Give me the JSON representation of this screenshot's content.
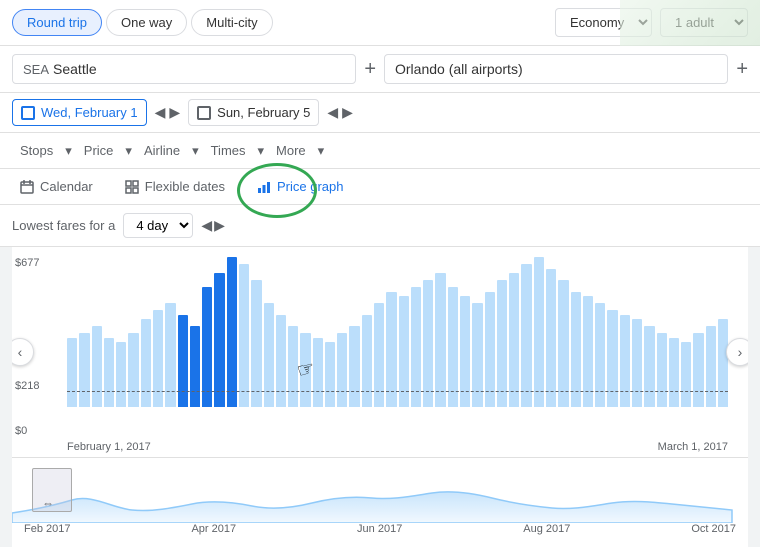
{
  "tripTypes": [
    {
      "label": "Round trip",
      "active": true
    },
    {
      "label": "One way",
      "active": false
    },
    {
      "label": "Multi-city",
      "active": false
    }
  ],
  "cabin": {
    "label": "Economy",
    "value": "economy"
  },
  "passengers": {
    "label": "1 adult"
  },
  "origin": {
    "iata": "SEA",
    "city": "Seattle"
  },
  "originAddBtn": "+",
  "destination": {
    "label": "Orlando (all airports)"
  },
  "destinationAddBtn": "+",
  "departureDateLabel": "Wed, February 1",
  "returnDateLabel": "Sun, February 5",
  "filters": [
    {
      "label": "Stops"
    },
    {
      "label": "Price"
    },
    {
      "label": "Airline"
    },
    {
      "label": "Times"
    },
    {
      "label": "More"
    }
  ],
  "views": [
    {
      "label": "Calendar",
      "icon": "calendar"
    },
    {
      "label": "Flexible dates",
      "icon": "grid"
    },
    {
      "label": "Price graph",
      "icon": "bar-chart",
      "active": true
    }
  ],
  "lowestFaresLabel": "Lowest fares for a",
  "duration": "4 day",
  "chart": {
    "topPrice": "$677",
    "midPrice": "$218",
    "bottomPrice": "$0",
    "xLabels": [
      "February 1, 2017",
      "March 1, 2017"
    ],
    "bars": [
      30,
      32,
      35,
      30,
      28,
      32,
      38,
      42,
      45,
      40,
      35,
      52,
      58,
      65,
      62,
      55,
      45,
      40,
      35,
      32,
      30,
      28,
      32,
      35,
      40,
      45,
      50,
      48,
      52,
      55,
      58,
      52,
      48,
      45,
      50,
      55,
      58,
      62,
      65,
      60,
      55,
      50,
      48,
      45,
      42,
      40,
      38,
      35,
      32,
      30,
      28,
      32,
      35,
      38
    ],
    "selectedRange": [
      9,
      10,
      11,
      12,
      13
    ]
  },
  "miniChart": {
    "xLabels": [
      "Feb 2017",
      "Apr 2017",
      "Jun 2017",
      "Aug 2017",
      "Oct 2017"
    ]
  },
  "navLeft": "‹",
  "navRight": "›"
}
